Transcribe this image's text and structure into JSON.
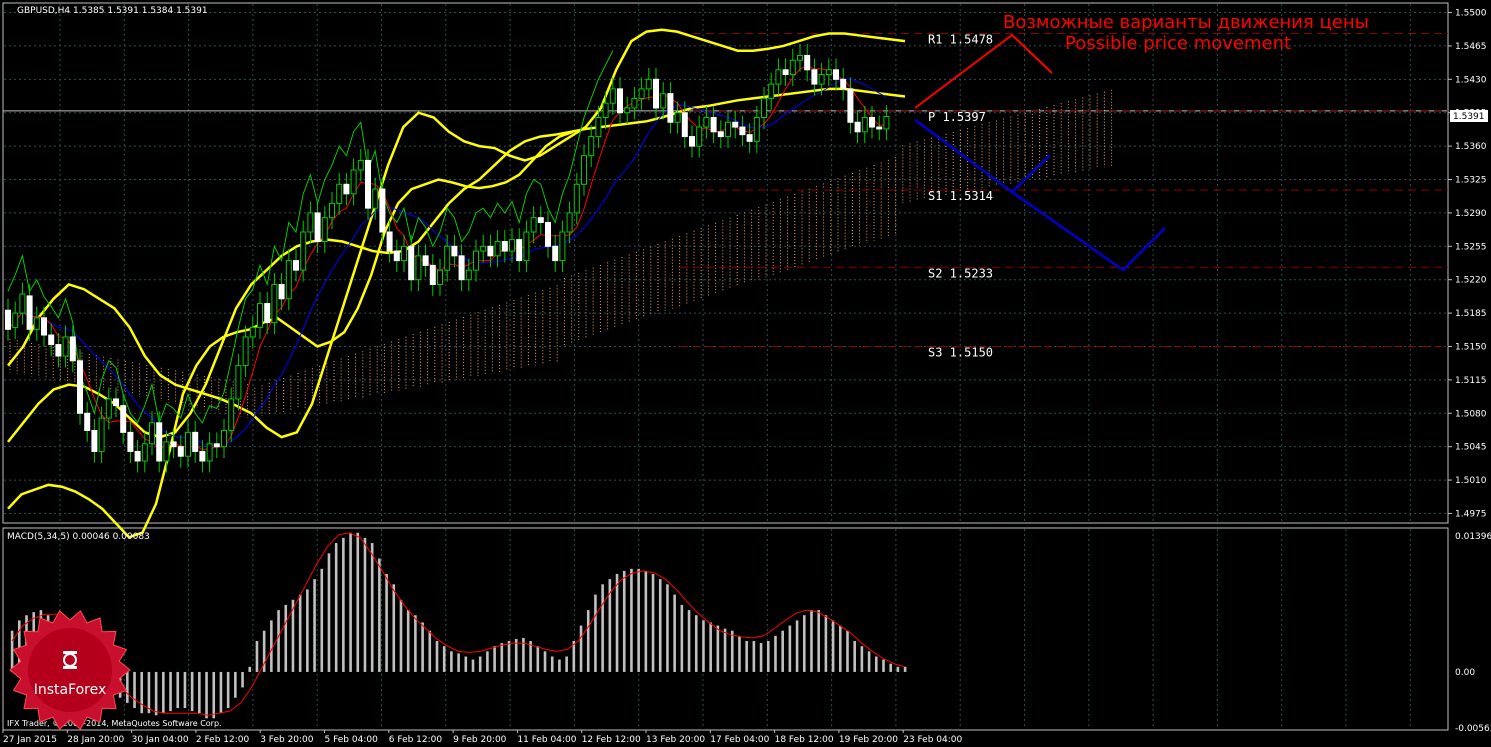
{
  "window": {
    "header": "GBPUSD,H4  1.5385 1.5391 1.5384 1.5391",
    "indicator_header": "MACD(5,34,5) 0.00046 0.00083",
    "copyright": "IFX Trader, © 2001-2014, MetaQuotes Software Corp.",
    "logo_text": "InstaForex",
    "price_marker": "1.5391"
  },
  "annotations": {
    "title_ru": "Возможные варианты движения цены",
    "title_en": "Possible price movement"
  },
  "levels": [
    {
      "label": "R1 1.5478",
      "price": 1.5478
    },
    {
      "label": "P 1.5397",
      "price": 1.5397
    },
    {
      "label": "S1 1.5314",
      "price": 1.5314
    },
    {
      "label": "S2 1.5233",
      "price": 1.5233
    },
    {
      "label": "S3 1.5150",
      "price": 1.515
    }
  ],
  "colors": {
    "background": "#000000",
    "grid": "#2f4f4f",
    "bull_candle": "#ffffff",
    "bear_candle": "#ffffff",
    "bollinger": "#ffff00",
    "kijun": "#0000ff",
    "tenkan": "#ff0000",
    "chikou": "#00cc00",
    "cloud_up": "#f4a460",
    "macd_hist": "#c0c0c0",
    "macd_signal": "#ff0000",
    "level_line": "#8b0000",
    "up_path": "#ff0000",
    "down_path": "#0000cd",
    "annotation_text": "#ff0000"
  },
  "chart_data": {
    "type": "candlestick",
    "symbol": "GBPUSD",
    "timeframe": "H4",
    "x_labels": [
      "27 Jan 2015",
      "28 Jan 20:00",
      "30 Jan 04:00",
      "2 Feb 12:00",
      "3 Feb 20:00",
      "5 Feb 04:00",
      "6 Feb 12:00",
      "9 Feb 20:00",
      "11 Feb 04:00",
      "12 Feb 12:00",
      "13 Feb 20:00",
      "17 Feb 04:00",
      "18 Feb 12:00",
      "19 Feb 20:00",
      "23 Feb 04:00"
    ],
    "y_ticks": [
      "1.5500",
      "1.5465",
      "1.5430",
      "1.5395",
      "1.5360",
      "1.5325",
      "1.5290",
      "1.5255",
      "1.5220",
      "1.5185",
      "1.5150",
      "1.5115",
      "1.5080",
      "1.5045",
      "1.5010",
      "1.4975"
    ],
    "ylim": [
      1.4965,
      1.551
    ],
    "close": [
      1.5168,
      1.5185,
      1.5205,
      1.5168,
      1.518,
      1.5162,
      1.5152,
      1.514,
      1.516,
      1.5135,
      1.508,
      1.5062,
      1.504,
      1.5075,
      1.5095,
      1.5088,
      1.506,
      1.504,
      1.503,
      1.5048,
      1.507,
      1.503,
      1.505,
      1.5045,
      1.5035,
      1.506,
      1.504,
      1.503,
      1.5048,
      1.5045,
      1.5062,
      1.5095,
      1.513,
      1.516,
      1.517,
      1.5195,
      1.5175,
      1.5215,
      1.52,
      1.524,
      1.523,
      1.527,
      1.529,
      1.526,
      1.5285,
      1.53,
      1.532,
      1.531,
      1.5335,
      1.5345,
      1.5295,
      1.5315,
      1.527,
      1.525,
      1.524,
      1.5255,
      1.522,
      1.5245,
      1.5235,
      1.5215,
      1.523,
      1.5255,
      1.5245,
      1.522,
      1.523,
      1.525,
      1.5255,
      1.5245,
      1.526,
      1.525,
      1.5262,
      1.524,
      1.527,
      1.5285,
      1.528,
      1.5255,
      1.524,
      1.527,
      1.529,
      1.532,
      1.535,
      1.537,
      1.539,
      1.5405,
      1.542,
      1.5395,
      1.54,
      1.541,
      1.542,
      1.543,
      1.54,
      1.5415,
      1.5385,
      1.5395,
      1.537,
      1.536,
      1.538,
      1.539,
      1.5375,
      1.537,
      1.5385,
      1.538,
      1.5372,
      1.5365,
      1.539,
      1.541,
      1.5425,
      1.544,
      1.5435,
      1.545,
      1.5455,
      1.544,
      1.5425,
      1.5435,
      1.544,
      1.543,
      1.542,
      1.5385,
      1.5375,
      1.539,
      1.538,
      1.5378,
      1.5391
    ],
    "open_offsets": [
      0.002,
      -0.0015,
      -0.002,
      0.0035,
      -0.0012,
      0.0018,
      0.001,
      0.0012,
      -0.002,
      0.0025,
      0.0055,
      0.0018,
      0.0022,
      -0.0035,
      -0.002,
      0.0007,
      0.0028,
      0.002,
      0.001,
      -0.0018,
      -0.0022,
      0.004,
      -0.002,
      0.0005,
      0.001,
      -0.0025,
      0.002,
      0.001,
      -0.0018,
      0.0003,
      -0.0017,
      -0.0033,
      -0.0035,
      -0.003,
      -0.001,
      -0.0025,
      0.002,
      -0.004,
      0.0015,
      -0.004,
      0.001,
      -0.004,
      -0.002,
      0.003,
      -0.0025,
      -0.0015,
      -0.002,
      0.001,
      -0.0025,
      -0.001,
      0.005,
      -0.002,
      0.0045,
      0.002,
      0.001,
      -0.0015,
      0.0035,
      -0.0025,
      0.001,
      0.002,
      -0.0015,
      -0.0025,
      0.001,
      0.0025,
      -0.001,
      -0.002,
      -0.0005,
      0.001,
      -0.0015,
      0.001,
      -0.0012,
      0.0022,
      -0.003,
      -0.0015,
      0.0005,
      0.0025,
      0.0015,
      -0.003,
      -0.002,
      -0.003,
      -0.003,
      -0.002,
      -0.002,
      -0.0015,
      -0.0015,
      0.0025,
      -0.0005,
      -0.001,
      -0.001,
      -0.001,
      0.003,
      -0.0015,
      0.003,
      -0.001,
      0.0025,
      0.001,
      -0.002,
      -0.001,
      0.0015,
      0.0005,
      -0.0015,
      0.0005,
      0.0008,
      0.0007,
      -0.0025,
      -0.002,
      -0.0015,
      -0.0015,
      0.0005,
      -0.0015,
      -0.0005,
      0.0015,
      0.0015,
      -0.001,
      -0.0005,
      0.001,
      0.001,
      0.0035,
      0.001,
      -0.0015,
      0.001,
      0.0002,
      -0.0013
    ],
    "bollinger_upper": [
      1.513,
      1.515,
      1.518,
      1.52,
      1.5215,
      1.521,
      1.52,
      1.519,
      1.517,
      1.514,
      1.512,
      1.511,
      1.5105,
      1.51,
      1.5095,
      1.5088,
      1.508,
      1.5065,
      1.5055,
      1.506,
      1.509,
      1.514,
      1.519,
      1.524,
      1.529,
      1.534,
      1.538,
      1.5395,
      1.539,
      1.5375,
      1.5365,
      1.536,
      1.5358,
      1.535,
      1.5345,
      1.535,
      1.536,
      1.537,
      1.538,
      1.54,
      1.544,
      1.547,
      1.548,
      1.5482,
      1.548,
      1.5475,
      1.547,
      1.5465,
      1.546,
      1.546,
      1.5462,
      1.5465,
      1.547,
      1.5475,
      1.5478,
      1.5478,
      1.5476,
      1.5474,
      1.5472,
      1.547
    ],
    "bollinger_mid": [
      1.505,
      1.507,
      1.509,
      1.5105,
      1.511,
      1.5108,
      1.51,
      1.509,
      1.5075,
      1.506,
      1.5055,
      1.506,
      1.508,
      1.511,
      1.515,
      1.519,
      1.5215,
      1.523,
      1.5245,
      1.5255,
      1.526,
      1.5262,
      1.526,
      1.5255,
      1.525,
      1.5248,
      1.525,
      1.526,
      1.528,
      1.53,
      1.5315,
      1.5325,
      1.534,
      1.5355,
      1.5365,
      1.537,
      1.5372,
      1.5375,
      1.5378,
      1.538,
      1.5382,
      1.5384,
      1.5386,
      1.539,
      1.5395,
      1.54,
      1.5402,
      1.5405,
      1.5408,
      1.541,
      1.5412,
      1.5414,
      1.5416,
      1.5418,
      1.542,
      1.542,
      1.5418,
      1.5416,
      1.5414,
      1.5412
    ],
    "bollinger_lower": [
      1.498,
      1.4995,
      1.5,
      1.5005,
      1.5003,
      1.4998,
      1.499,
      1.498,
      1.4965,
      1.495,
      1.4955,
      1.4985,
      1.504,
      1.51,
      1.513,
      1.515,
      1.516,
      1.5165,
      1.5168,
      1.5175,
      1.518,
      1.517,
      1.516,
      1.515,
      1.5155,
      1.5165,
      1.519,
      1.5225,
      1.527,
      1.53,
      1.5315,
      1.532,
      1.5325,
      1.5322,
      1.5318,
      1.5316,
      1.5318,
      1.5322,
      1.533,
      1.5345,
      1.536,
      1.537,
      1.5375
    ],
    "macd_hist": [
      0.004,
      0.005,
      0.0055,
      0.0058,
      0.006,
      0.0055,
      0.005,
      0.004,
      0.003,
      0.0015,
      0.001,
      -0.0005,
      -0.001,
      -0.0015,
      -0.002,
      -0.0025,
      -0.003,
      -0.0035,
      -0.004,
      -0.004,
      -0.0042,
      -0.004,
      -0.0038,
      -0.0035,
      -0.0035,
      -0.0038,
      -0.004,
      -0.0045,
      -0.0045,
      -0.004,
      -0.0035,
      -0.0025,
      -0.0015,
      0.0005,
      0.003,
      0.004,
      0.005,
      0.006,
      0.0065,
      0.007,
      0.0075,
      0.008,
      0.009,
      0.01,
      0.0115,
      0.0125,
      0.013,
      0.0135,
      0.0135,
      0.013,
      0.0125,
      0.011,
      0.0095,
      0.0085,
      0.007,
      0.006,
      0.0055,
      0.0048,
      0.004,
      0.003,
      0.0025,
      0.002,
      0.0018,
      0.0015,
      0.0012,
      0.0015,
      0.002,
      0.0025,
      0.0028,
      0.003,
      0.0032,
      0.0033,
      0.003,
      0.0025,
      0.002,
      0.0015,
      0.0012,
      0.0015,
      0.003,
      0.0045,
      0.006,
      0.0075,
      0.0085,
      0.009,
      0.0095,
      0.0098,
      0.01,
      0.01,
      0.0098,
      0.0095,
      0.009,
      0.0085,
      0.0075,
      0.0065,
      0.006,
      0.0055,
      0.005,
      0.0048,
      0.0045,
      0.0042,
      0.004,
      0.0035,
      0.003,
      0.003,
      0.0028,
      0.003,
      0.0035,
      0.004,
      0.0045,
      0.005,
      0.0055,
      0.006,
      0.006,
      0.0055,
      0.005,
      0.0045,
      0.004,
      0.003,
      0.0025,
      0.002,
      0.0015,
      0.0012,
      0.0008,
      0.0005,
      0.0005
    ],
    "macd_ylim": [
      -0.00563,
      0.01396
    ],
    "macd_ticks": [
      "0.01396",
      "0.00",
      "-0.00563"
    ],
    "macd_signal": [
      0.003,
      0.0045,
      0.0052,
      0.0056,
      0.0056,
      0.005,
      0.004,
      0.0025,
      0.001,
      -0.0005,
      -0.0015,
      -0.0025,
      -0.0032,
      -0.0038,
      -0.004,
      -0.004,
      -0.004,
      -0.004,
      -0.0042,
      -0.004,
      -0.0038,
      -0.003,
      -0.0015,
      0.0005,
      0.0025,
      0.0045,
      0.0065,
      0.0085,
      0.0105,
      0.0122,
      0.0133,
      0.0135,
      0.013,
      0.0115,
      0.0098,
      0.008,
      0.0065,
      0.0052,
      0.0042,
      0.0032,
      0.0025,
      0.002,
      0.0019,
      0.002,
      0.0023,
      0.0026,
      0.0028,
      0.0028,
      0.0025,
      0.0022,
      0.002,
      0.0022,
      0.003,
      0.0045,
      0.0062,
      0.0078,
      0.009,
      0.0096,
      0.0098,
      0.0096,
      0.009,
      0.008,
      0.0068,
      0.0057,
      0.0048,
      0.004,
      0.0036,
      0.0034,
      0.0033,
      0.0035,
      0.0042,
      0.005,
      0.0057,
      0.006,
      0.0058,
      0.0052,
      0.0045,
      0.0038,
      0.0028,
      0.002,
      0.0013,
      0.0008,
      0.0005
    ]
  }
}
